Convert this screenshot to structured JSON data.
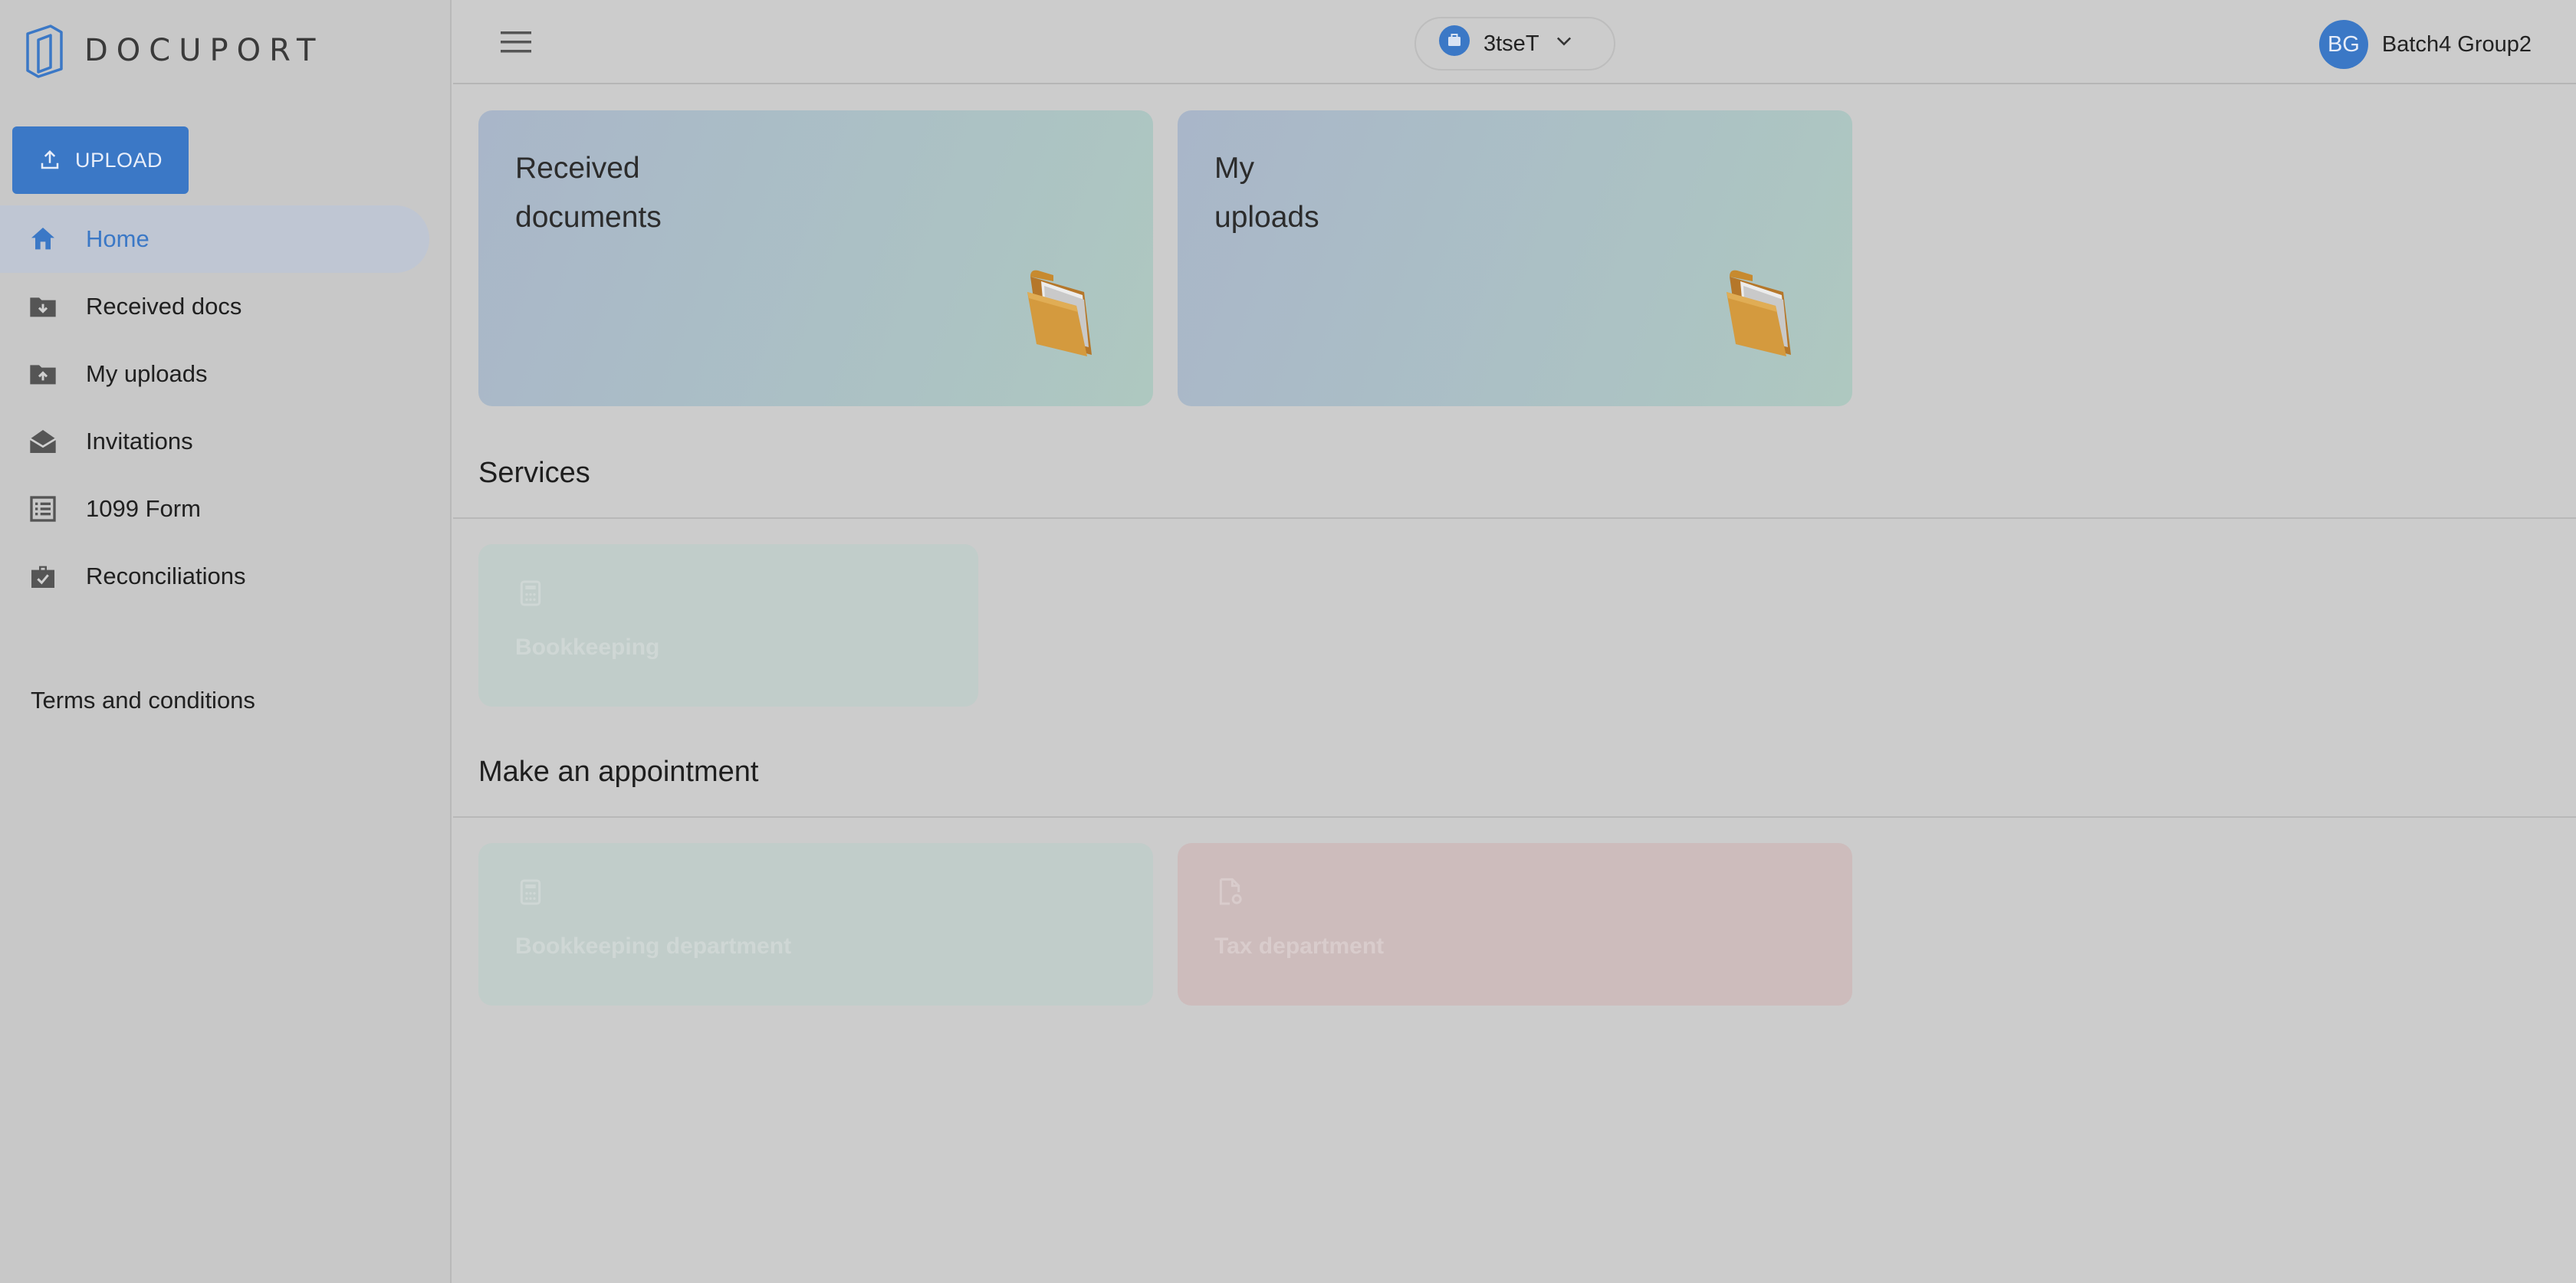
{
  "app": {
    "logo_text": "DOCUPORT"
  },
  "sidebar": {
    "upload_label": "UPLOAD",
    "items": [
      {
        "label": "Home",
        "icon": "home-icon",
        "active": true
      },
      {
        "label": "Received docs",
        "icon": "folder-download-icon"
      },
      {
        "label": "My uploads",
        "icon": "folder-upload-icon"
      },
      {
        "label": "Invitations",
        "icon": "envelope-open-icon"
      },
      {
        "label": "1099 Form",
        "icon": "form-list-icon"
      },
      {
        "label": "Reconciliations",
        "icon": "briefcase-check-icon"
      }
    ],
    "terms_label": "Terms and conditions"
  },
  "topbar": {
    "company": "3tseT",
    "user_initials": "BG",
    "user_name": "Batch4 Group2"
  },
  "cards": [
    {
      "title": "Received\ndocuments",
      "icon": "folder-3d-icon"
    },
    {
      "title": "My\nuploads",
      "icon": "folder-3d-icon"
    }
  ],
  "services": {
    "title": "Services",
    "items": [
      {
        "label": "Bookkeeping",
        "icon": "calculator-icon"
      }
    ]
  },
  "appointment": {
    "title": "Make an appointment",
    "items": [
      {
        "label": "Bookkeeping department",
        "icon": "calculator-icon"
      },
      {
        "label": "Tax department",
        "icon": "document-gear-icon"
      }
    ]
  },
  "colors": {
    "accent": "#3b78c6",
    "overlay": "#cccccc"
  }
}
